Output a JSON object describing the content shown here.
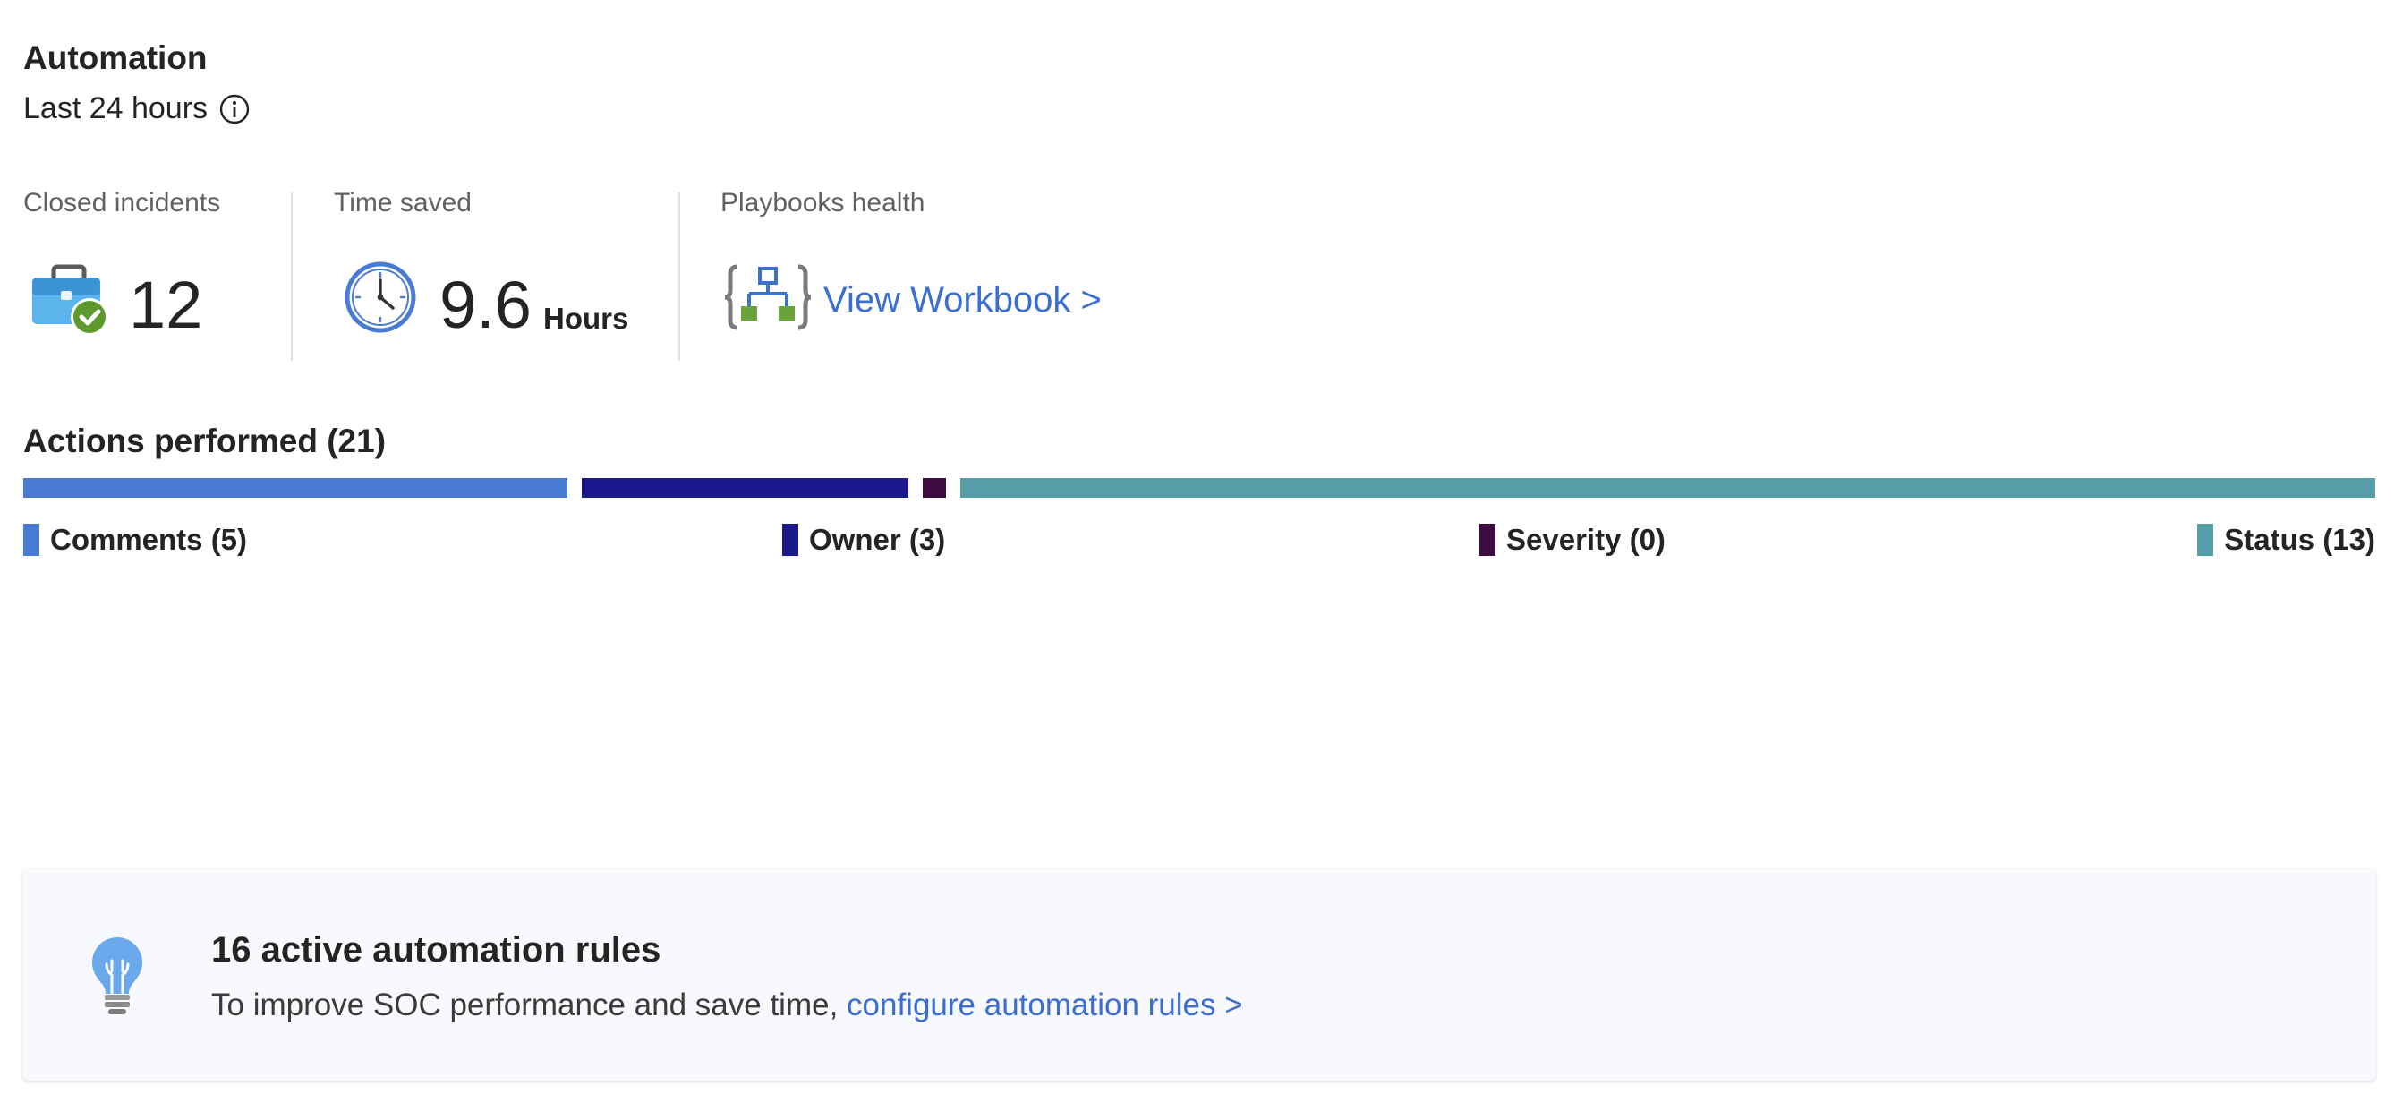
{
  "header": {
    "title": "Automation",
    "timeframe": "Last 24 hours",
    "timeframe_info_icon": "info-icon"
  },
  "metrics": {
    "closed_incidents": {
      "label": "Closed incidents",
      "value": "12",
      "icon": "toolbox-check-icon"
    },
    "time_saved": {
      "label": "Time saved",
      "value": "9.6",
      "unit": "Hours",
      "icon": "clock-icon"
    },
    "playbooks_health": {
      "label": "Playbooks health",
      "link": "View Workbook >",
      "icon": "playbook-workflow-icon"
    }
  },
  "actions": {
    "title": "Actions performed (21)",
    "total": 21,
    "segments": [
      {
        "name": "Comments",
        "count": 5,
        "label": "Comments (5)",
        "color": "#4a7bd2"
      },
      {
        "name": "Owner",
        "count": 3,
        "label": "Owner (3)",
        "color": "#1a1a8c"
      },
      {
        "name": "Severity",
        "count": 0,
        "label": "Severity (0)",
        "color": "#3d0b3f"
      },
      {
        "name": "Status",
        "count": 13,
        "label": "Status (13)",
        "color": "#569ea7"
      }
    ]
  },
  "tip": {
    "icon": "lightbulb-icon",
    "title": "16 active automation rules",
    "text": "To improve SOC performance and save time,",
    "link": "configure automation rules >"
  }
}
